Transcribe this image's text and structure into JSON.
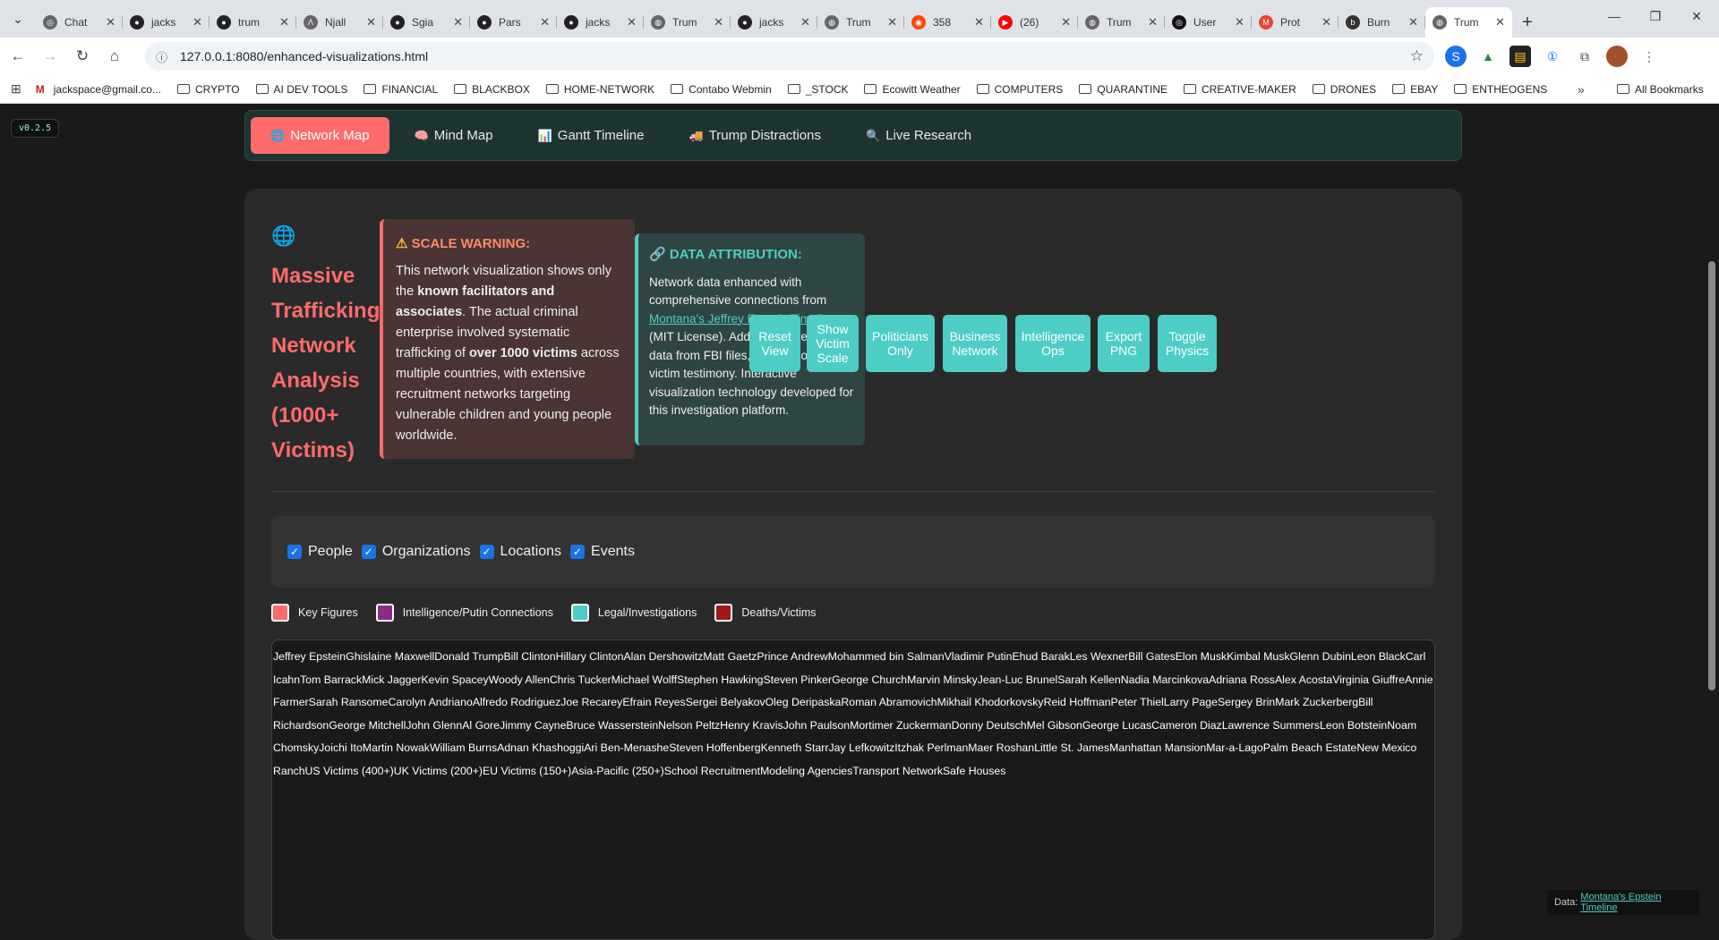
{
  "browser": {
    "tabs": [
      {
        "title": "Chat",
        "icon": "chatgpt-icon"
      },
      {
        "title": "jacks",
        "icon": "github-icon"
      },
      {
        "title": "trum",
        "icon": "github-icon"
      },
      {
        "title": "Njall",
        "icon": "njall-icon"
      },
      {
        "title": "Sgia",
        "icon": "github-icon"
      },
      {
        "title": "Pars",
        "icon": "github-icon"
      },
      {
        "title": "jacks",
        "icon": "github-icon"
      },
      {
        "title": "Trum",
        "icon": "globe-icon"
      },
      {
        "title": "jacks",
        "icon": "github-icon"
      },
      {
        "title": "Trum",
        "icon": "globe-icon"
      },
      {
        "title": "358",
        "icon": "reddit-icon"
      },
      {
        "title": "(26)",
        "icon": "youtube-icon"
      },
      {
        "title": "Trum",
        "icon": "globe-icon"
      },
      {
        "title": "User",
        "icon": "openai-icon"
      },
      {
        "title": "Prot",
        "icon": "gmail-icon"
      },
      {
        "title": "Burn",
        "icon": "bm-icon"
      },
      {
        "title": "Trum",
        "icon": "globe-icon",
        "active": true
      }
    ],
    "url": "127.0.0.1:8080/enhanced-visualizations.html",
    "bookmarks": [
      "jackspace@gmail.co...",
      "CRYPTO",
      "AI DEV TOOLS",
      "FINANCIAL",
      "BLACKBOX",
      "HOME-NETWORK",
      "Contabo Webmin",
      "_STOCK",
      "Ecowitt Weather",
      "COMPUTERS",
      "QUARANTINE",
      "CREATIVE-MAKER",
      "DRONES",
      "EBAY",
      "ENTHEOGENS"
    ],
    "all_bookmarks": "All Bookmarks"
  },
  "version": "v0.2.5",
  "nav": [
    {
      "label": "Network Map",
      "icon": "globe-icon",
      "glyph": "🌐",
      "active": true
    },
    {
      "label": "Mind Map",
      "icon": "brain-icon",
      "glyph": "🧠"
    },
    {
      "label": "Gantt Timeline",
      "icon": "chart-icon",
      "glyph": "📊"
    },
    {
      "label": "Trump Distractions",
      "icon": "truck-icon",
      "glyph": "🚚"
    },
    {
      "label": "Live Research",
      "icon": "search-icon",
      "glyph": "🔍"
    }
  ],
  "header": {
    "title": "Massive Trafficking Network Analysis (1000+ Victims)"
  },
  "warning": {
    "title": "SCALE WARNING:",
    "t1": "This network visualization shows only the ",
    "b1": "known facilitators and associates",
    "t2": ". The actual criminal enterprise involved systematic trafficking of ",
    "b2": "over 1000 victims",
    "t3": " across multiple countries, with extensive recruitment networks targeting vulnerable children and young people worldwide."
  },
  "attribution": {
    "title": "DATA ATTRIBUTION:",
    "t1": "Network data enhanced with comprehensive connections from ",
    "link": "Montana's Jeffrey Epstein Timeline",
    "t2": " (MIT License). Additional investigative data from FBI files, court records, and victim testimony. Interactive visualization technology developed for this investigation platform."
  },
  "controls": [
    "Reset View",
    "Show Victim Scale",
    "Politicians Only",
    "Business Network",
    "Intelligence Ops",
    "Export PNG",
    "Toggle Physics"
  ],
  "filters": [
    {
      "label": "People",
      "checked": true
    },
    {
      "label": "Organizations",
      "checked": true
    },
    {
      "label": "Locations",
      "checked": true
    },
    {
      "label": "Events",
      "checked": true
    }
  ],
  "legend": [
    {
      "label": "Key Figures",
      "color": "#ff6b6b"
    },
    {
      "label": "Intelligence/Putin Connections",
      "color": "#8e2a86"
    },
    {
      "label": "Legal/Investigations",
      "color": "#4ecdc4"
    },
    {
      "label": "Deaths/Victims",
      "color": "#a01818"
    }
  ],
  "nodes": [
    "Jeffrey Epstein",
    "Ghislaine Maxwell",
    "Donald Trump",
    "Bill Clinton",
    "Hillary Clinton",
    "Alan Dershowitz",
    "Matt Gaetz",
    "Prince Andrew",
    "Mohammed bin Salman",
    "Vladimir Putin",
    "Ehud Barak",
    "Les Wexner",
    "Bill Gates",
    "Elon Musk",
    "Kimbal Musk",
    "Glenn Dubin",
    "Leon Black",
    "Carl Icahn",
    "Tom Barrack",
    "Mick Jagger",
    "Kevin Spacey",
    "Woody Allen",
    "Chris Tucker",
    "Michael Wolff",
    "Stephen Hawking",
    "Steven Pinker",
    "George Church",
    "Marvin Minsky",
    "Jean-Luc Brunel",
    "Sarah Kellen",
    "Nadia Marcinkova",
    "Adriana Ross",
    "Alex Acosta",
    "Virginia Giuffre",
    "Annie Farmer",
    "Sarah Ransome",
    "Carolyn Andriano",
    "Alfredo Rodriguez",
    "Joe Recarey",
    "Efrain Reyes",
    "Sergei Belyakov",
    "Oleg Deripaska",
    "Roman Abramovich",
    "Mikhail Khodorkovsky",
    "Reid Hoffman",
    "Peter Thiel",
    "Larry Page",
    "Sergey Brin",
    "Mark Zuckerberg",
    "Bill Richardson",
    "George Mitchell",
    "John Glenn",
    "Al Gore",
    "Jimmy Cayne",
    "Bruce Wasserstein",
    "Nelson Peltz",
    "Henry Kravis",
    "John Paulson",
    "Mortimer Zuckerman",
    "Donny Deutsch",
    "Mel Gibson",
    "George Lucas",
    "Cameron Diaz",
    "Lawrence Summers",
    "Leon Botstein",
    "Noam Chomsky",
    "Joichi Ito",
    "Martin Nowak",
    "William Burns",
    "Adnan Khashoggi",
    "Ari Ben-Menashe",
    "Steven Hoffenberg",
    "Kenneth Starr",
    "Jay Lefkowitz",
    "Itzhak Perlman",
    "Maer Roshan",
    "Little St. James",
    "Manhattan Mansion",
    "Mar-a-Lago",
    "Palm Beach Estate",
    "New Mexico Ranch",
    "US Victims (400+)",
    "UK Victims (200+)",
    "EU Victims (150+)",
    "Asia-Pacific (250+)",
    "School Recruitment",
    "Modeling Agencies",
    "Transport Network",
    "Safe Houses"
  ],
  "credit": {
    "prefix": "Data:",
    "link": "Montana's Epstein Timeline"
  }
}
